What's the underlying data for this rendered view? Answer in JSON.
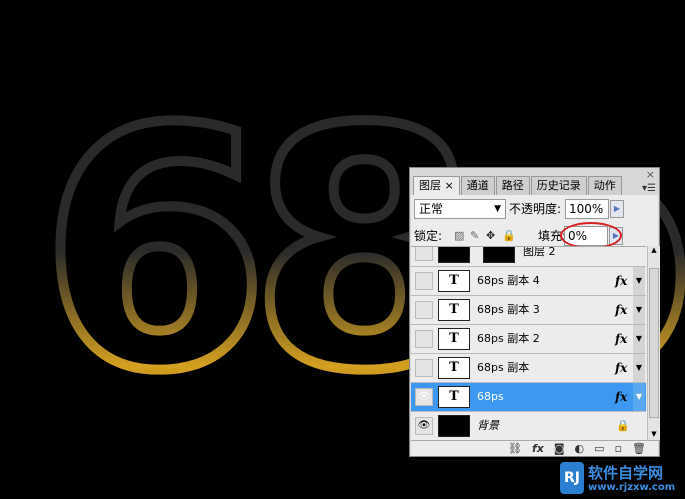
{
  "canvas": {
    "text": "68ps",
    "stroke_color": "#2a2a2a",
    "gold": "#d4a020"
  },
  "panel": {
    "tabs": [
      {
        "label": "图层",
        "active": true
      },
      {
        "label": "通道"
      },
      {
        "label": "路径"
      },
      {
        "label": "历史记录"
      },
      {
        "label": "动作"
      }
    ],
    "tab_close": "×",
    "close": "×",
    "menu": "▾☰",
    "blend_mode": "正常",
    "opacity_label": "不透明度:",
    "opacity": "100%",
    "lock_label": "锁定:",
    "fill_label": "填充:",
    "fill": "0%",
    "layers": [
      {
        "name": "图层 2",
        "visible": false
      },
      {
        "name": "68ps 副本 4",
        "visible": false,
        "fx": "fx"
      },
      {
        "name": "68ps 副本 3",
        "visible": false,
        "fx": "fx"
      },
      {
        "name": "68ps 副本 2",
        "visible": false,
        "fx": "fx"
      },
      {
        "name": "68ps 副本",
        "visible": false,
        "fx": "fx"
      },
      {
        "name": "68ps",
        "visible": true,
        "selected": true,
        "fx": "fx"
      },
      {
        "name": "背景",
        "visible": true,
        "locked": true
      }
    ],
    "thumb_glyph": "T",
    "eye_glyph": "👁",
    "bottom_icons": [
      "link-icon",
      "fx-icon",
      "mask-icon",
      "adjustment-icon",
      "folder-icon",
      "new-layer-icon",
      "trash-icon"
    ]
  },
  "watermark": {
    "title": "软件自学网",
    "url": "www.rjzxw.com"
  }
}
